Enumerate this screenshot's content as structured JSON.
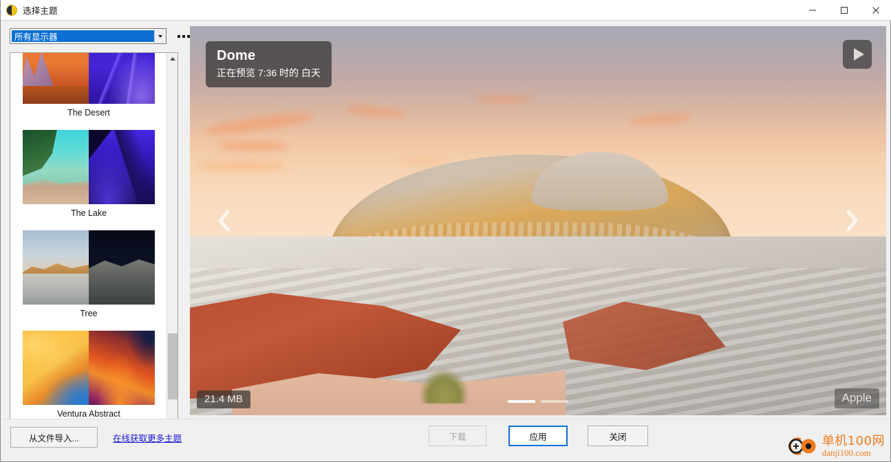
{
  "window": {
    "title": "选择主题",
    "app_icon": "theme-app-icon",
    "controls": {
      "minimize": "minimize-icon",
      "maximize": "maximize-icon",
      "close": "close-icon"
    }
  },
  "toolbar": {
    "monitor_selector": {
      "value": "所有显示器",
      "icon": "chevron-down-icon"
    },
    "more_options": "ellipsis-icon"
  },
  "theme_list": {
    "items": [
      {
        "label": "The Desert",
        "thumb": "desert-thumbnail"
      },
      {
        "label": "The Lake",
        "thumb": "lake-thumbnail"
      },
      {
        "label": "Tree",
        "thumb": "tree-thumbnail"
      },
      {
        "label": "Ventura Abstract",
        "thumb": "ventura-abstract-thumbnail"
      }
    ],
    "scrollbar": {
      "up": "scroll-up-icon",
      "down": "scroll-down-icon"
    }
  },
  "preview": {
    "info": {
      "title": "Dome",
      "subtitle": "正在预览 7:36 时的 白天"
    },
    "play_label": "play-icon",
    "prev_label": "chevron-left-icon",
    "next_label": "chevron-right-icon",
    "file_size": "21.4 MB",
    "author": "Apple",
    "pagination": {
      "total": 2,
      "active": 1
    }
  },
  "footer": {
    "import_button": "从文件导入...",
    "more_themes_link": "在线获取更多主题",
    "download_button": "下载",
    "apply_button": "应用",
    "close_button": "关闭"
  },
  "watermark": {
    "cn": "单机100网",
    "en": "danji100.com",
    "color": "#f07c1e"
  },
  "colors": {
    "accent": "#0c6fd4",
    "link": "#1515d2",
    "window_bg": "#f0f0f0",
    "panel_bg": "#ffffff"
  }
}
